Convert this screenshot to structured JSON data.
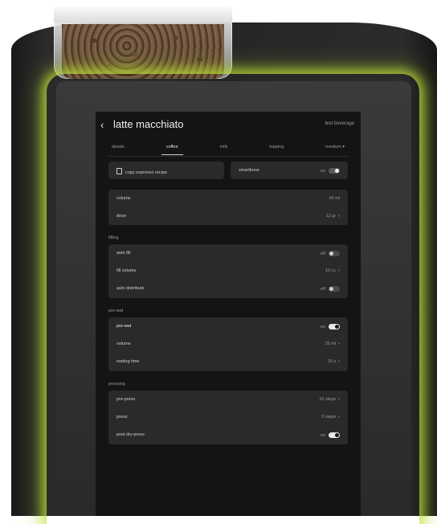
{
  "header": {
    "title": "latte macchiato",
    "test_label": "test beverage"
  },
  "tabs": [
    {
      "label": "details"
    },
    {
      "label": "coffee"
    },
    {
      "label": "milk"
    },
    {
      "label": "topping"
    },
    {
      "label": "medium ▾"
    }
  ],
  "top": {
    "copy_label": "copy espresso recipe",
    "smartbrew_label": "smartbrew",
    "smartbrew_state": "on"
  },
  "basic": {
    "volume_label": "volume",
    "volume_value": "40 ml",
    "dose_label": "dose",
    "dose_value": "12 gr"
  },
  "filling": {
    "section": "filling",
    "auto_fill_label": "auto fill",
    "auto_fill_state": "off",
    "fill_volume_label": "fill volume",
    "fill_volume_value": "10 cc",
    "auto_distribute_label": "auto distribute",
    "auto_distribute_state": "off"
  },
  "prewet": {
    "section": "pre-wet",
    "prewet_label": "pre-wet",
    "prewet_state": "on",
    "volume_label": "volume",
    "volume_value": "20 ml",
    "resting_label": "resting time",
    "resting_value": "15 s"
  },
  "pressing": {
    "section": "pressing",
    "prepress_label": "pre-press",
    "prepress_value": "10 steps",
    "press_label": "press",
    "press_value": "0 steps",
    "post_label": "post dry-press",
    "post_state": "on"
  },
  "colors": {
    "glow": "#c4e63c",
    "screen": "#141414",
    "card": "#2a2a2a"
  }
}
